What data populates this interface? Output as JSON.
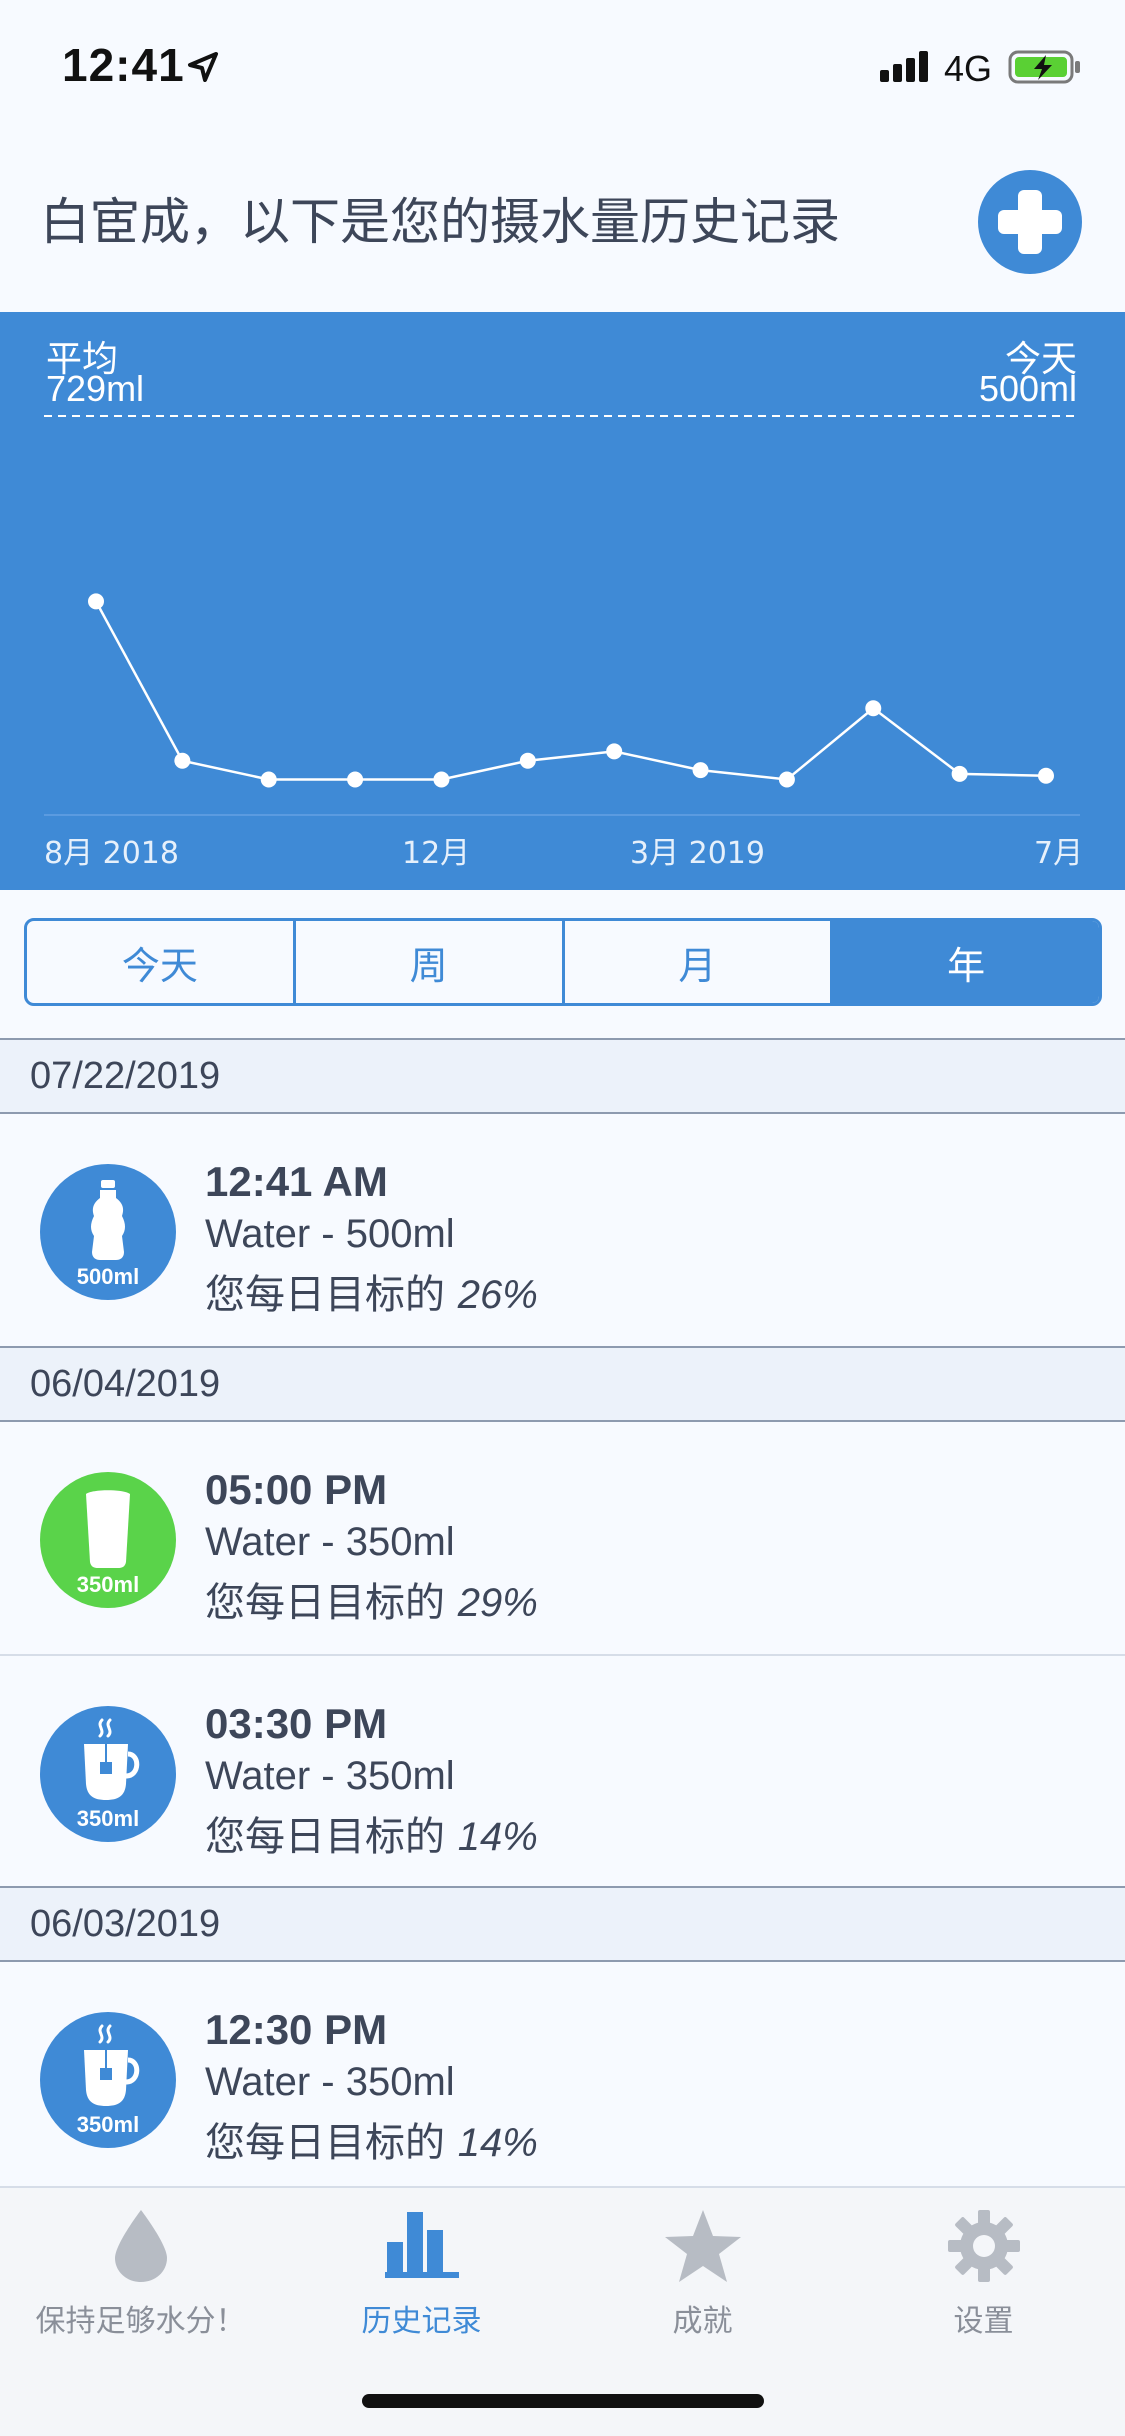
{
  "status_bar": {
    "time": "12:41",
    "network": "4G",
    "battery_color": "#5ad034"
  },
  "header": {
    "title": "白宦成，以下是您的摄水量历史记录"
  },
  "chart_summary": {
    "average_label": "平均",
    "average_value": "729ml",
    "today_label": "今天",
    "today_value": "500ml"
  },
  "chart_data": {
    "type": "line",
    "x": [
      "2018-08",
      "2018-09",
      "2018-10",
      "2018-11",
      "2018-12",
      "2019-01",
      "2019-02",
      "2019-03",
      "2019-04",
      "2019-05",
      "2019-06",
      "2019-07"
    ],
    "series": [
      {
        "values": [
          1150,
          300,
          200,
          200,
          200,
          300,
          350,
          250,
          200,
          580,
          230,
          220
        ]
      }
    ],
    "x_tick_labels": [
      "8月 2018",
      "12月",
      "3月 2019",
      "7月"
    ],
    "average_line": 729,
    "grid": false
  },
  "segments": {
    "items": [
      "今天",
      "周",
      "月",
      "年"
    ],
    "selected": "年"
  },
  "history": [
    {
      "date": "07/22/2019",
      "entries": [
        {
          "time": "12:41 AM",
          "desc": "Water - 500ml",
          "goal_prefix": "您每日目标的",
          "goal_pct": "26%",
          "icon": "bottle-icon",
          "amount": "500ml",
          "color": "#3f8ad6"
        }
      ]
    },
    {
      "date": "06/04/2019",
      "entries": [
        {
          "time": "05:00 PM",
          "desc": "Water - 350ml",
          "goal_prefix": "您每日目标的",
          "goal_pct": "29%",
          "icon": "glass-icon",
          "amount": "350ml",
          "color": "#5ad34a"
        },
        {
          "time": "03:30 PM",
          "desc": "Water - 350ml",
          "goal_prefix": "您每日目标的",
          "goal_pct": "14%",
          "icon": "tea-cup-icon",
          "amount": "350ml",
          "color": "#3f8ad6"
        }
      ]
    },
    {
      "date": "06/03/2019",
      "entries": [
        {
          "time": "12:30 PM",
          "desc": "Water - 350ml",
          "goal_prefix": "您每日目标的",
          "goal_pct": "14%",
          "icon": "tea-cup-icon",
          "amount": "350ml",
          "color": "#3f8ad6"
        }
      ]
    }
  ],
  "tab_bar": {
    "tabs": [
      {
        "label": "保持足够水分！",
        "icon": "water-drop-icon"
      },
      {
        "label": "历史记录",
        "icon": "bar-chart-icon"
      },
      {
        "label": "成就",
        "icon": "star-icon"
      },
      {
        "label": "设置",
        "icon": "gear-icon"
      }
    ],
    "active_index": 1,
    "accent": "#3f8ad6"
  }
}
